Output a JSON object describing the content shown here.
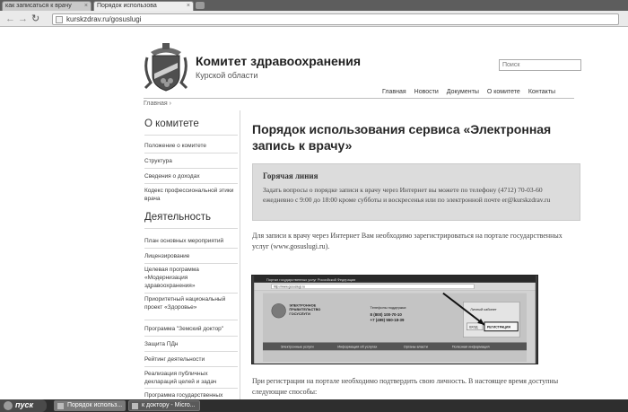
{
  "browser": {
    "tabs": [
      {
        "label": "как записаться к врачу",
        "active": false
      },
      {
        "label": "Порядок использова",
        "active": true
      }
    ],
    "url": "kurskzdrav.ru/gosuslugi",
    "icons": {
      "back": "back-arrow-icon",
      "forward": "forward-arrow-icon",
      "reload": "reload-icon"
    }
  },
  "header": {
    "title": "Комитет здравоохранения",
    "subtitle": "Курской области",
    "search_placeholder": "Поиск",
    "nav": [
      "Главная",
      "Новости",
      "Документы",
      "О комитете",
      "Контакты"
    ],
    "breadcrumb": "Главная ›"
  },
  "sidebar": {
    "about_heading": "О комитете",
    "about_items": [
      "Положение о комитете",
      "Структура",
      "Сведения о доходах",
      "Кодекс профессиональной этики врача"
    ],
    "activity_heading": "Деятельность",
    "activity_items": [
      "План основных мероприятий",
      "Лицензирование",
      "Целевая программа «Модернизация здравоохранения»",
      "Приоритетный национальный проект «Здоровье»",
      "Программа \"Земский доктор\"",
      "Защита ПДн",
      "Рейтинг деятельности",
      "Реализация публичных деклараций целей и задач",
      "Программа государственных"
    ]
  },
  "main": {
    "title": "Порядок использования сервиса «Электронная запись к врачу»",
    "hotline_title": "Горячая линия",
    "hotline_text": "Задать вопросы о порядке записи к врачу через Интернет вы можете по телефону (4712) 70-03-60 ежедневно с 9:00 до 18:00 кроме субботы и воскресенья или по электронной почте er@kurskzdrav.ru",
    "intro": "Для записи к врачу через Интернет Вам необходимо зарегистрироваться на портале государственных услуг (www.gosuslugi.ru).",
    "after": "При регистрации на портале необходимо подтвердить свою личность. В настоящее время доступны следующие способы:"
  },
  "screenshot": {
    "window_title": "Портал государственных услуг Российской Федерации",
    "url": "http://www.gosuslugi.ru",
    "portal_name": "ЭЛЕКТРОННОЕ ПРАВИТЕЛЬСТВО ГОСУСЛУГИ",
    "hotline_label": "Телефоны поддержки:",
    "phone1": "8 (800) 100-70-10",
    "phone2": "+7 (499) 550-18-39",
    "account_label": "Личный кабинет",
    "login_label": "ВХОД",
    "register_label": "РЕГИСТРАЦИЯ",
    "menu": [
      "Электронные услуги",
      "Информация об услугах",
      "Органы власти",
      "Полезная информация"
    ]
  },
  "taskbar": {
    "start_label": "пуск",
    "tasks": [
      "Порядок использ...",
      "к доктору - Micro..."
    ]
  }
}
